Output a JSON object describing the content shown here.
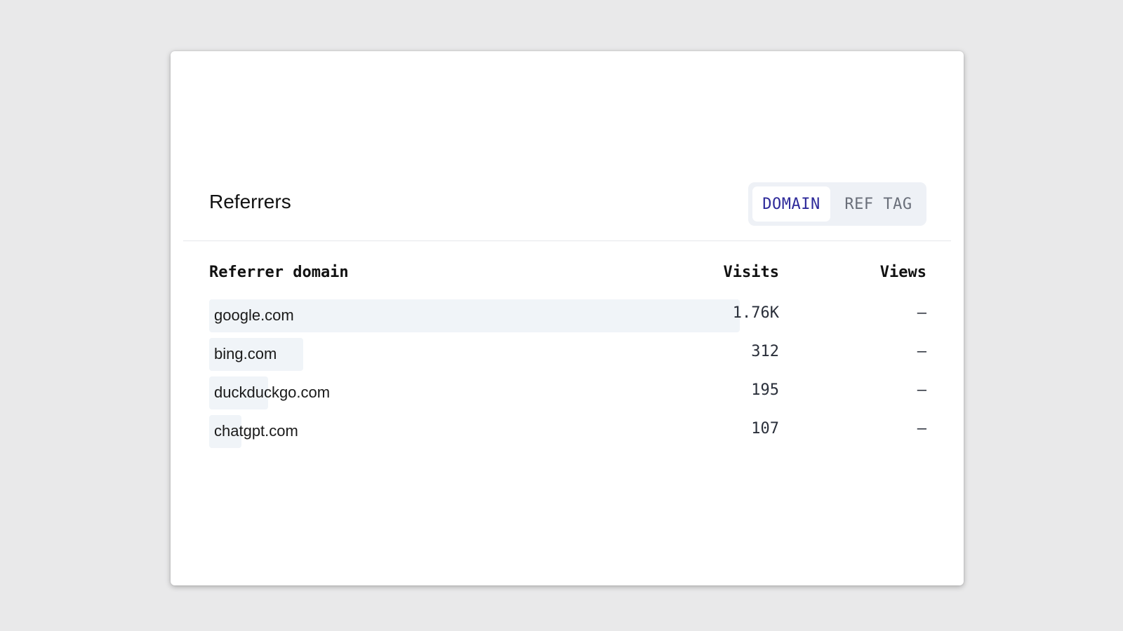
{
  "card": {
    "title": "Referrers",
    "toggle": {
      "options": [
        {
          "label": "DOMAIN",
          "active": true
        },
        {
          "label": "REF TAG",
          "active": false
        }
      ]
    }
  },
  "table": {
    "headers": {
      "domain": "Referrer domain",
      "visits": "Visits",
      "views": "Views"
    },
    "rows": [
      {
        "domain": "google.com",
        "visits": "1.76K",
        "views": "–",
        "share": 1.0
      },
      {
        "domain": "bing.com",
        "visits": "312",
        "views": "–",
        "share": 0.177
      },
      {
        "domain": "duckduckgo.com",
        "visits": "195",
        "views": "–",
        "share": 0.111
      },
      {
        "domain": "chatgpt.com",
        "visits": "107",
        "views": "–",
        "share": 0.061
      }
    ]
  },
  "colors": {
    "background": "#e9e9ea",
    "card": "#ffffff",
    "accent": "#2e2a9a",
    "bar": "#f0f4f8"
  }
}
